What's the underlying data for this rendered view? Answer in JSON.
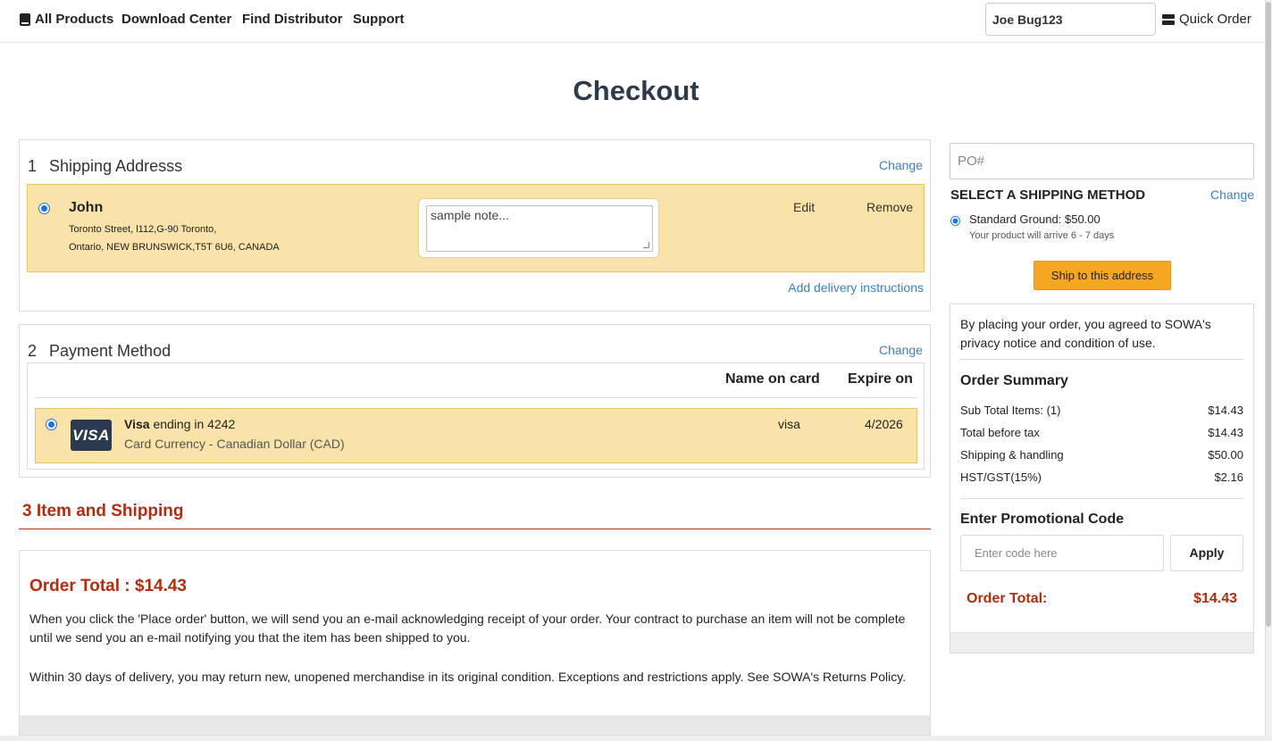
{
  "nav": {
    "links": [
      "All Products",
      "Download Center",
      "Find Distributor",
      "Support"
    ],
    "user": "Joe Bug123",
    "quick_order": "Quick Order"
  },
  "page_title": "Checkout",
  "shipping": {
    "number": "1",
    "title": "Shipping Addresss",
    "change": "Change",
    "name": "John",
    "address_line1": "Toronto Street, l112,G-90 Toronto,",
    "address_line2": "Ontario, NEW BRUNSWICK,T5T 6U6, CANADA",
    "note": "sample note...",
    "edit": "Edit",
    "remove": "Remove",
    "add_instructions": "Add delivery instructions"
  },
  "payment": {
    "number": "2",
    "title": "Payment Method",
    "change": "Change",
    "col_name": "Name on card",
    "col_expire": "Expire on",
    "card_brand": "Visa",
    "card_logo": "VISA",
    "ending_text": "ending in 4242",
    "currency": "Card Currency - Canadian Dollar (CAD)",
    "name_on_card": "visa",
    "expire": "4/2026"
  },
  "items": {
    "number": "3",
    "title": "Item and Shipping",
    "order_total": "Order Total : $14.43",
    "para1": "When you click the 'Place order' button, we will send you an e-mail acknowledging receipt of your order. Your contract to purchase an item will not be complete until we send you an e-mail notifying you that the item has been shipped to you.",
    "para2": "Within 30 days of delivery, you may return new, unopened merchandise in its original condition. Exceptions and restrictions apply. See SOWA's  Returns Policy."
  },
  "sidebar": {
    "po_placeholder": "PO#",
    "ship_method_title": "SELECT A SHIPPING METHOD",
    "change": "Change",
    "standard_label": "Standard Ground:",
    "standard_price": "$50.00",
    "arrival": "Your product will arrive 6 - 7 days",
    "ship_button": "Ship to this address",
    "agreement": "By placing your order, you agreed to SOWA's privacy notice and condition of use.",
    "summary_title": "Order Summary",
    "rows": [
      {
        "label": "Sub Total Items: (1)",
        "value": "$14.43"
      },
      {
        "label": "Total before tax",
        "value": "$14.43"
      },
      {
        "label": "Shipping & handling",
        "value": "$50.00"
      },
      {
        "label": "HST/GST(15%)",
        "value": "$2.16"
      }
    ],
    "promo_title": "Enter Promotional Code",
    "promo_placeholder": "Enter code here",
    "apply": "Apply",
    "order_total_label": "Order Total:",
    "order_total_value": "$14.43"
  },
  "colors": {
    "accent_red": "#b22d10",
    "highlight": "#f9e3a8",
    "button_orange": "#f5a623",
    "link_blue": "#3b7fc4"
  }
}
